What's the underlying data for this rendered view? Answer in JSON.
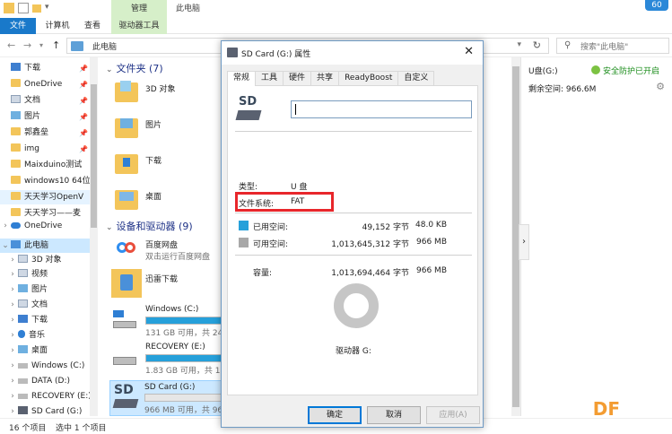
{
  "window": {
    "manage_tab": "管理",
    "title": "此电脑",
    "badge": "60"
  },
  "ribbon": {
    "file": "文件",
    "computer": "计算机",
    "view": "查看",
    "drive_tools": "驱动器工具"
  },
  "address": {
    "crumb": "此电脑",
    "search_placeholder": "搜索\"此电脑\""
  },
  "nav": {
    "quick": [
      {
        "label": "下载",
        "icon": "download-icon"
      },
      {
        "label": "OneDrive",
        "icon": "folder-icon"
      },
      {
        "label": "文档",
        "icon": "document-icon"
      },
      {
        "label": "图片",
        "icon": "picture-icon"
      },
      {
        "label": "郭鑫垒",
        "icon": "folder-icon"
      },
      {
        "label": "img",
        "icon": "folder-icon"
      },
      {
        "label": "Maixduino测试",
        "icon": "folder-icon"
      },
      {
        "label": "windows10 64位",
        "icon": "folder-icon"
      },
      {
        "label": "天天学习OpenV",
        "icon": "folder-icon"
      },
      {
        "label": "天天学习——麦",
        "icon": "folder-icon"
      }
    ],
    "onedrive": "OneDrive",
    "this_pc": "此电脑",
    "pc_items": [
      {
        "label": "3D 对象",
        "icon": "3d-objects-icon"
      },
      {
        "label": "视频",
        "icon": "video-icon"
      },
      {
        "label": "图片",
        "icon": "picture-icon"
      },
      {
        "label": "文档",
        "icon": "document-icon"
      },
      {
        "label": "下载",
        "icon": "download-icon"
      },
      {
        "label": "音乐",
        "icon": "music-icon"
      },
      {
        "label": "桌面",
        "icon": "desktop-icon"
      },
      {
        "label": "Windows (C:)",
        "icon": "drive-icon"
      },
      {
        "label": "DATA (D:)",
        "icon": "drive-icon"
      },
      {
        "label": "RECOVERY (E:)",
        "icon": "drive-icon"
      },
      {
        "label": "SD Card (G:)",
        "icon": "sd-card-icon"
      }
    ]
  },
  "content": {
    "folders_group": "文件夹 (7)",
    "folders": [
      "3D 对象",
      "图片",
      "下载",
      "桌面"
    ],
    "devices_group": "设备和驱动器 (9)",
    "baidu_name": "百度网盘",
    "baidu_desc": "双击运行百度网盘",
    "xunlei_name": "迅雷下载",
    "drives": [
      {
        "name": "Windows (C:)",
        "size": "131 GB 可用，共 248",
        "used": 0.47
      },
      {
        "name": "RECOVERY (E:)",
        "size": "1.83 GB 可用，共 12.",
        "used": 0.85
      },
      {
        "name": "SD Card (G:)",
        "size": "966 MB 可用，共 966",
        "used": 0.0
      }
    ]
  },
  "detail": {
    "name": "U盘(G:)",
    "safe": "安全防护已开启",
    "free": "剩余空间: 966.6M"
  },
  "status": {
    "count": "16 个项目",
    "selected": "选中 1 个项目"
  },
  "watermark": "DF",
  "dialog": {
    "title": "SD Card (G:) 属性",
    "tabs": [
      "常规",
      "工具",
      "硬件",
      "共享",
      "ReadyBoost",
      "自定义"
    ],
    "type_label": "类型:",
    "type_value": "U 盘",
    "fs_label": "文件系统:",
    "fs_value": "FAT",
    "used_label": "已用空间:",
    "used_bytes": "49,152 字节",
    "used_hr": "48.0 KB",
    "free_label": "可用空间:",
    "free_bytes": "1,013,645,312 字节",
    "free_hr": "966 MB",
    "cap_label": "容量:",
    "cap_bytes": "1,013,694,464 字节",
    "cap_hr": "966 MB",
    "drive_label": "驱动器 G:",
    "ok": "确定",
    "cancel": "取消",
    "apply": "应用(A)",
    "colors": {
      "used": "#26a0da",
      "free": "#a8a8a8"
    }
  }
}
